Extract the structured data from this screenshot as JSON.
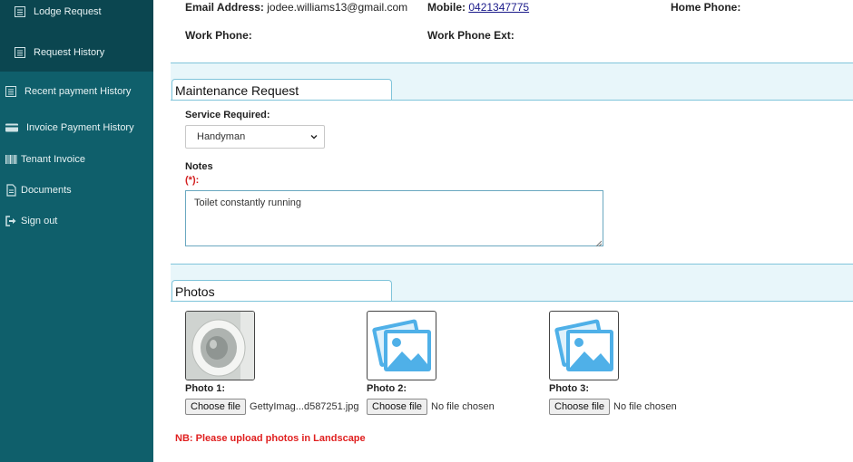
{
  "sidebar": {
    "items": [
      {
        "label": "Lodge Request",
        "icon": "list-icon"
      },
      {
        "label": "Request History",
        "icon": "list-icon"
      },
      {
        "label": "Recent payment History",
        "icon": "list-icon"
      },
      {
        "label": "Invoice Payment History",
        "icon": "credit-card-icon"
      },
      {
        "label": "Tenant Invoice",
        "icon": "barcode-icon"
      },
      {
        "label": "Documents",
        "icon": "document-icon"
      },
      {
        "label": "Sign out",
        "icon": "sign-out-icon"
      }
    ]
  },
  "contact": {
    "email_label": "Email Address:",
    "email_value": "jodee.williams13@gmail.com",
    "mobile_label": "Mobile:",
    "mobile_value": "0421347775",
    "home_phone_label": "Home Phone:",
    "work_phone_label": "Work Phone:",
    "work_phone_ext_label": "Work Phone Ext:"
  },
  "maintenance": {
    "title": "Maintenance Request",
    "service_label": "Service Required:",
    "service_value": "Handyman",
    "notes_label": "Notes",
    "notes_required": "(*):",
    "notes_value": "Toilet constantly running"
  },
  "photos": {
    "title": "Photos",
    "items": [
      {
        "label": "Photo 1:",
        "button": "Choose file",
        "file": "GettyImag...d587251.jpg"
      },
      {
        "label": "Photo 2:",
        "button": "Choose file",
        "file": "No file chosen"
      },
      {
        "label": "Photo 3:",
        "button": "Choose file",
        "file": "No file chosen"
      }
    ],
    "note": "NB: Please upload photos in Landscape"
  },
  "colors": {
    "sidebar_bg": "#0f5f6b",
    "sidebar_top_bg": "#0b4650",
    "section_border": "#7fc4da",
    "warning_text": "#e02020",
    "placeholder_icon": "#4fb0e8"
  }
}
